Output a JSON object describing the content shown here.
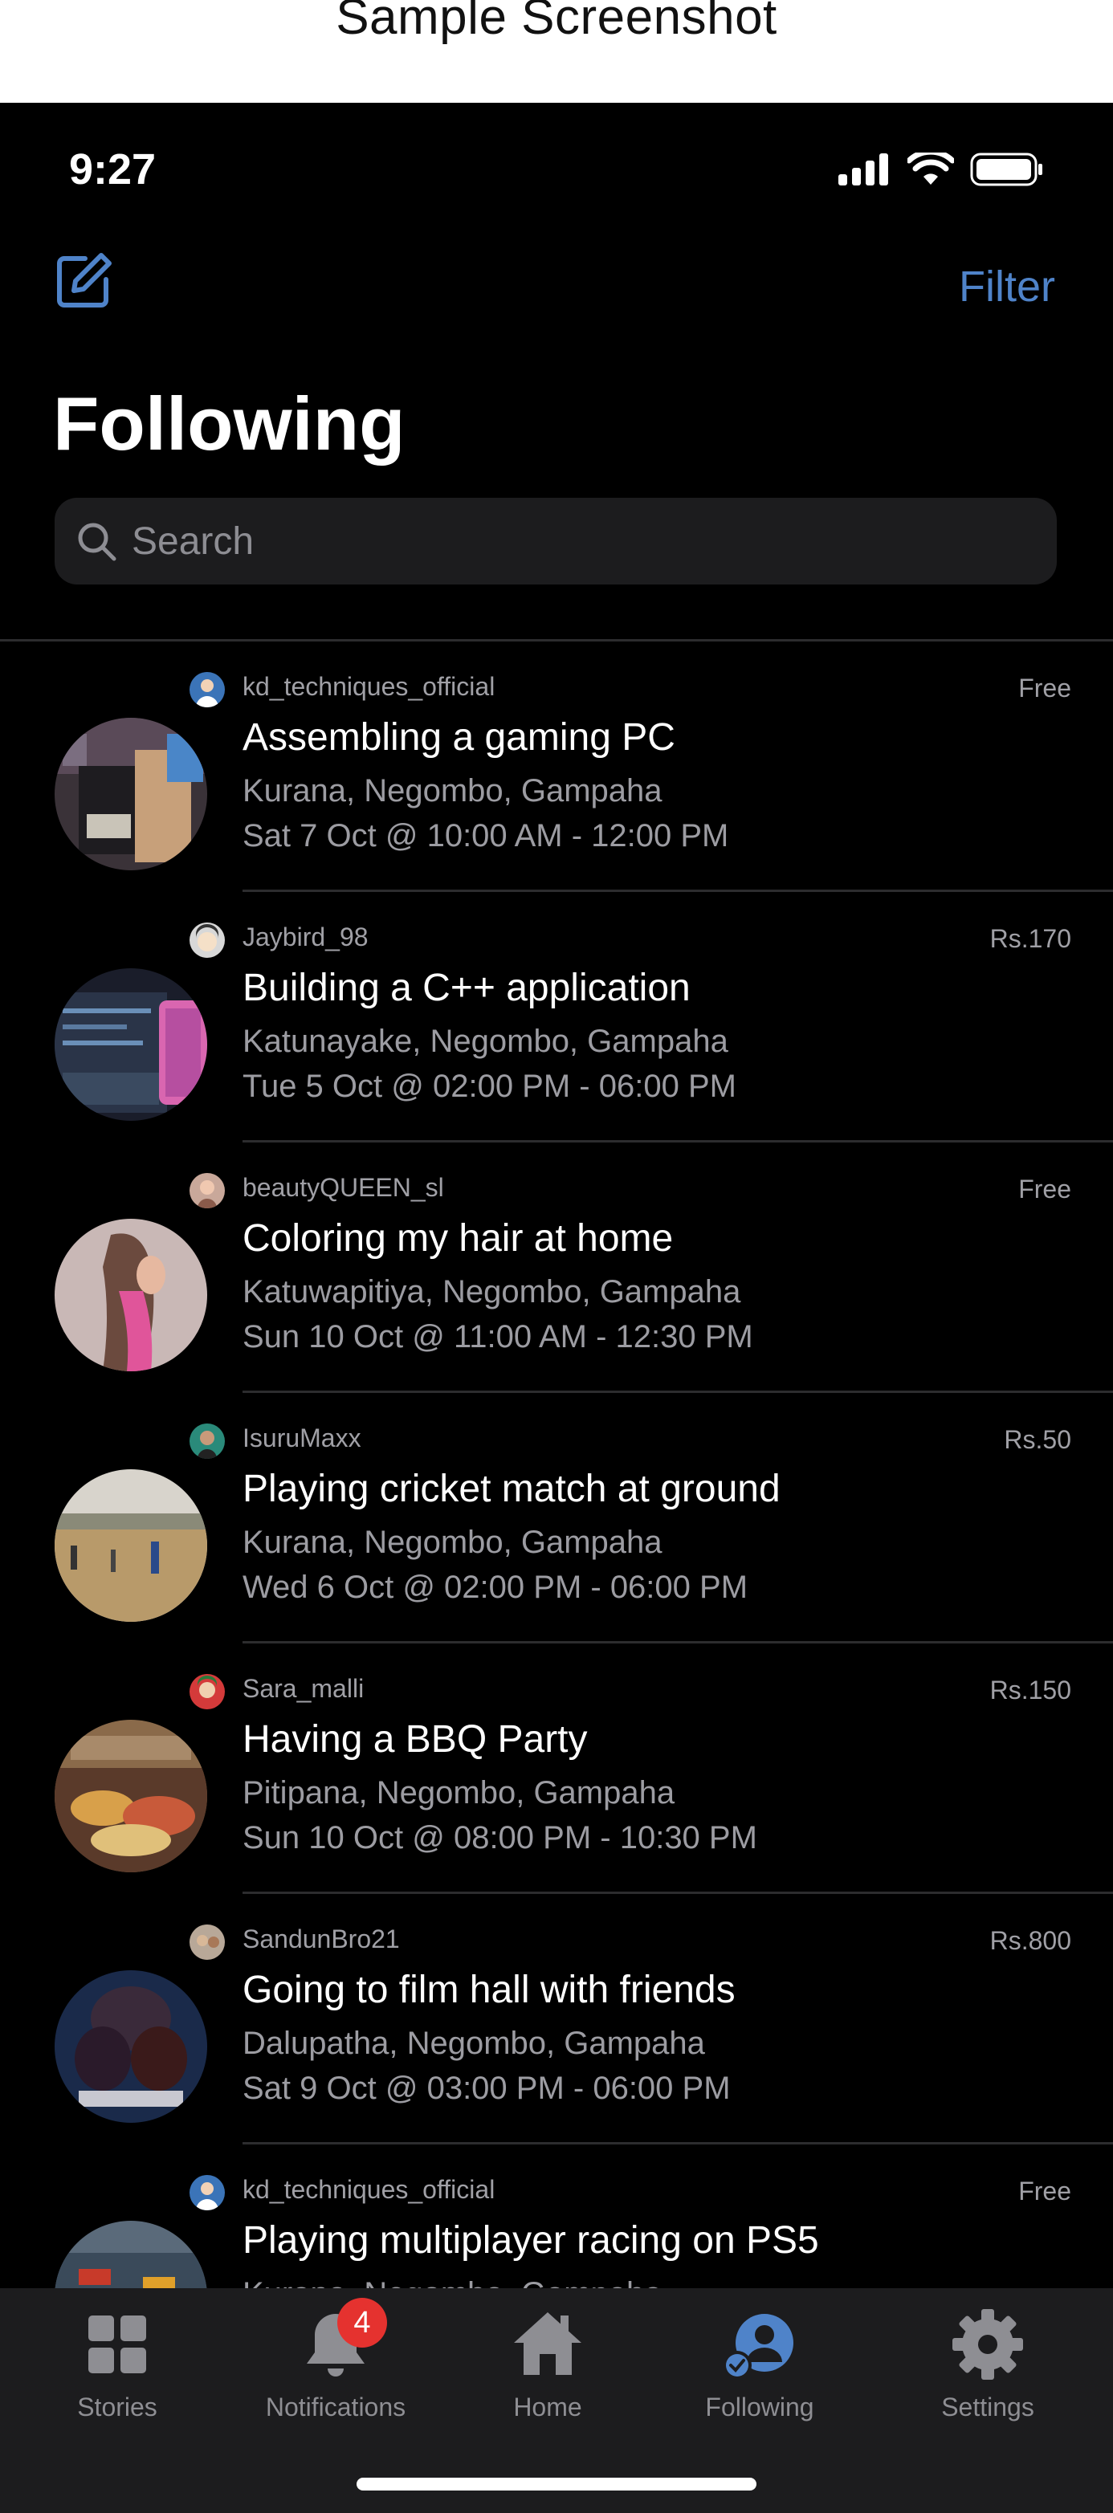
{
  "caption": "Sample Screenshot",
  "status_bar": {
    "time": "9:27"
  },
  "header": {
    "filter_label": "Filter",
    "title": "Following"
  },
  "search": {
    "placeholder": "Search"
  },
  "events": [
    {
      "username": "kd_techniques_official",
      "price": "Free",
      "title": "Assembling a gaming PC",
      "location": "Kurana, Negombo, Gampaha",
      "datetime": "Sat 7 Oct @ 10:00 AM - 12:00 PM"
    },
    {
      "username": "Jaybird_98",
      "price": "Rs.170",
      "title": "Building a C++ application",
      "location": "Katunayake, Negombo, Gampaha",
      "datetime": "Tue 5 Oct @ 02:00 PM - 06:00 PM"
    },
    {
      "username": "beautyQUEEN_sl",
      "price": "Free",
      "title": "Coloring my hair at home",
      "location": "Katuwapitiya, Negombo, Gampaha",
      "datetime": "Sun 10 Oct @ 11:00 AM - 12:30 PM"
    },
    {
      "username": "IsuruMaxx",
      "price": "Rs.50",
      "title": "Playing cricket match at ground",
      "location": "Kurana, Negombo, Gampaha",
      "datetime": "Wed 6 Oct @ 02:00 PM - 06:00 PM"
    },
    {
      "username": "Sara_malli",
      "price": "Rs.150",
      "title": "Having a BBQ Party",
      "location": "Pitipana, Negombo, Gampaha",
      "datetime": "Sun 10 Oct @ 08:00 PM - 10:30 PM"
    },
    {
      "username": "SandunBro21",
      "price": "Rs.800",
      "title": "Going to film hall with friends",
      "location": "Dalupatha, Negombo, Gampaha",
      "datetime": "Sat 9 Oct @ 03:00 PM - 06:00 PM"
    },
    {
      "username": "kd_techniques_official",
      "price": "Free",
      "title": "Playing multiplayer racing on PS5",
      "location": "Kurana, Negombo, Gampaha",
      "datetime": ""
    }
  ],
  "tabbar": {
    "items": [
      {
        "label": "Stories",
        "icon": "grid-icon"
      },
      {
        "label": "Notifications",
        "icon": "bell-icon",
        "badge": "4"
      },
      {
        "label": "Home",
        "icon": "house-icon"
      },
      {
        "label": "Following",
        "icon": "person-check-icon",
        "active": true
      },
      {
        "label": "Settings",
        "icon": "gear-icon"
      }
    ]
  },
  "colors": {
    "accent": "#4f83c9",
    "background": "#000000",
    "badge": "#e5322f"
  }
}
